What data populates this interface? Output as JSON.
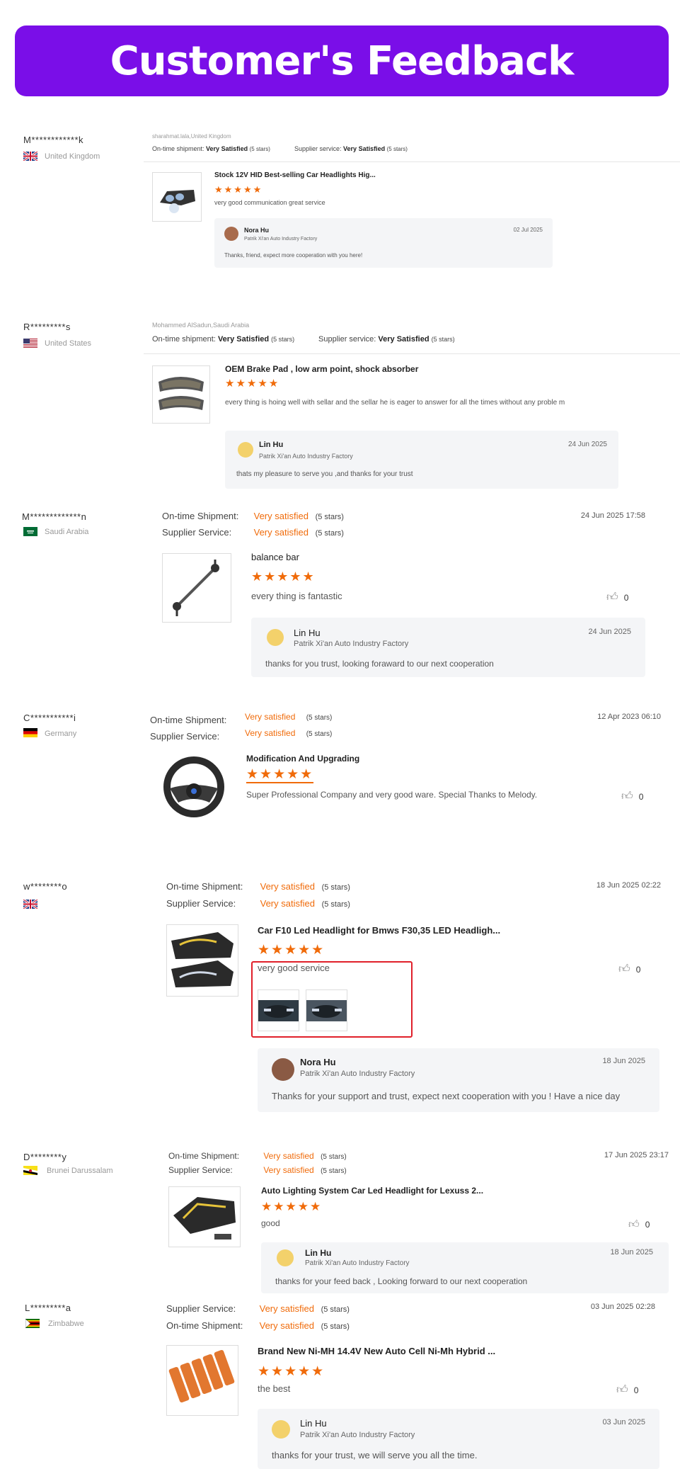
{
  "banner": {
    "title": "Customer's Feedback"
  },
  "labels": {
    "stars5": "(5 stars)",
    "ontime": "On-time shipment:",
    "supplier": "Supplier service:",
    "ontime2": "On-time Shipment:",
    "supplier2": "Supplier Service:"
  },
  "reviews": [
    {
      "user": "M************k",
      "country": "United Kingdom",
      "source": "sharahmat.lala,United Kingdom",
      "ontime_value": "Very Satisfied",
      "supplier_value": "Very Satisfied",
      "product": "Stock 12V HID Best-selling Car Headlights Hig...",
      "stars": "★★★★★",
      "comment": "very good communication great service",
      "reply": {
        "name": "Nora Hu",
        "company": "Patrik Xi'an Auto Industry Factory",
        "date": "02 Jul 2025",
        "text": "Thanks, friend, expect more cooperation with you here!"
      }
    },
    {
      "user": "R*********s",
      "country": "United States",
      "source": "Mohammed AlSadun,Saudi Arabia",
      "ontime_value": "Very Satisfied",
      "supplier_value": "Very Satisfied",
      "product": "OEM Brake Pad , low arm point, shock absorber",
      "stars": "★★★★★",
      "comment": "every thing is hoing well with sellar and the sellar he is eager to answer for all the times without any proble m",
      "reply": {
        "name": "Lin Hu",
        "company": "Patrik Xi'an Auto Industry Factory",
        "date": "24 Jun 2025",
        "text": "thats my pleasure to serve you ,and thanks for your trust"
      }
    },
    {
      "user": "M*************n",
      "country": "Saudi Arabia",
      "date": "24 Jun 2025 17:58",
      "ontime_value": "Very satisfied",
      "supplier_value": "Very satisfied",
      "product": "balance bar",
      "stars": "★★★★★",
      "comment": "every thing is fantastic",
      "likes": "0",
      "reply": {
        "name": "Lin Hu",
        "company": "Patrik Xi'an Auto Industry Factory",
        "date": "24 Jun 2025",
        "text": "thanks for you trust, looking foraward to our next cooperation"
      }
    },
    {
      "user": "C***********i",
      "country": "Germany",
      "date": "12 Apr 2023 06:10",
      "ontime_value": "Very satisfied",
      "supplier_value": "Very satisfied",
      "product": "Modification And Upgrading",
      "stars": "★★★★★",
      "comment": "Super Professional Company and very good ware. Special Thanks to Melody.",
      "likes": "0"
    },
    {
      "user": "w********o",
      "country": "",
      "date": "18 Jun 2025 02:22",
      "ontime_value": "Very satisfied",
      "supplier_value": "Very satisfied",
      "product": "Car F10 Led Headlight for Bmws F30,35 LED Headligh...",
      "stars": "★★★★★",
      "comment": "very good service",
      "likes": "0",
      "reply": {
        "name": "Nora Hu",
        "company": "Patrik Xi'an Auto Industry Factory",
        "date": "18 Jun 2025",
        "text": "Thanks for your support and trust, expect next cooperation with you ! Have a nice day"
      }
    },
    {
      "user": "D********y",
      "country": "Brunei Darussalam",
      "date": "17 Jun 2025 23:17",
      "ontime_value": "Very satisfied",
      "supplier_value": "Very satisfied",
      "product": "Auto Lighting System Car Led Headlight for Lexuss 2...",
      "stars": "★★★★★",
      "comment": "good",
      "likes": "0",
      "reply": {
        "name": "Lin Hu",
        "company": "Patrik Xi'an Auto Industry Factory",
        "date": "18 Jun 2025",
        "text": "thanks for your feed back , Looking forward to our next cooperation"
      }
    },
    {
      "user": "L*********a",
      "country": "Zimbabwe",
      "date": "03 Jun 2025 02:28",
      "ontime_value": "Very satisfied",
      "supplier_value": "Very satisfied",
      "product": "Brand New Ni-MH 14.4V New Auto Cell Ni-Mh Hybrid ...",
      "stars": "★★★★★",
      "comment": "the best",
      "likes": "0",
      "reply": {
        "name": "Lin Hu",
        "company": "Patrik Xi'an Auto Industry Factory",
        "date": "03 Jun 2025",
        "text": "thanks for your trust, we will serve you all the time."
      }
    }
  ],
  "colors": {
    "banner": "#7a0ee8",
    "accent": "#f06b0a",
    "highlight_box": "#e0202a"
  }
}
